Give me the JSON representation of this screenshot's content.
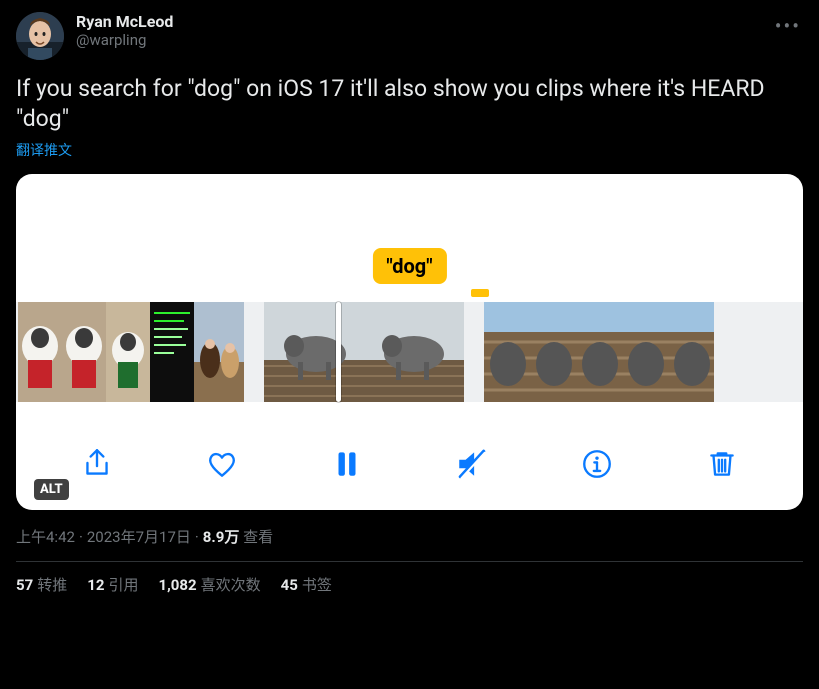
{
  "author": {
    "name": "Ryan McLeod",
    "handle": "@warpling"
  },
  "body": "If you search for \"dog\" on iOS 17 it'll also show you clips where it's HEARD \"dog\"",
  "translate_label": "翻译推文",
  "media": {
    "search_tag": "\"dog\"",
    "alt_badge": "ALT",
    "icons": {
      "share": "share-icon",
      "heart": "heart-icon",
      "pause": "pause-icon",
      "mute": "mute-icon",
      "info": "info-icon",
      "trash": "trash-icon"
    }
  },
  "meta": {
    "time": "上午4:42",
    "date": "2023年7月17日",
    "views_count": "8.9万",
    "views_label": "查看"
  },
  "stats": {
    "retweets_count": "57",
    "retweets_label": "转推",
    "quotes_count": "12",
    "quotes_label": "引用",
    "likes_count": "1,082",
    "likes_label": "喜欢次数",
    "bookmarks_count": "45",
    "bookmarks_label": "书签"
  }
}
